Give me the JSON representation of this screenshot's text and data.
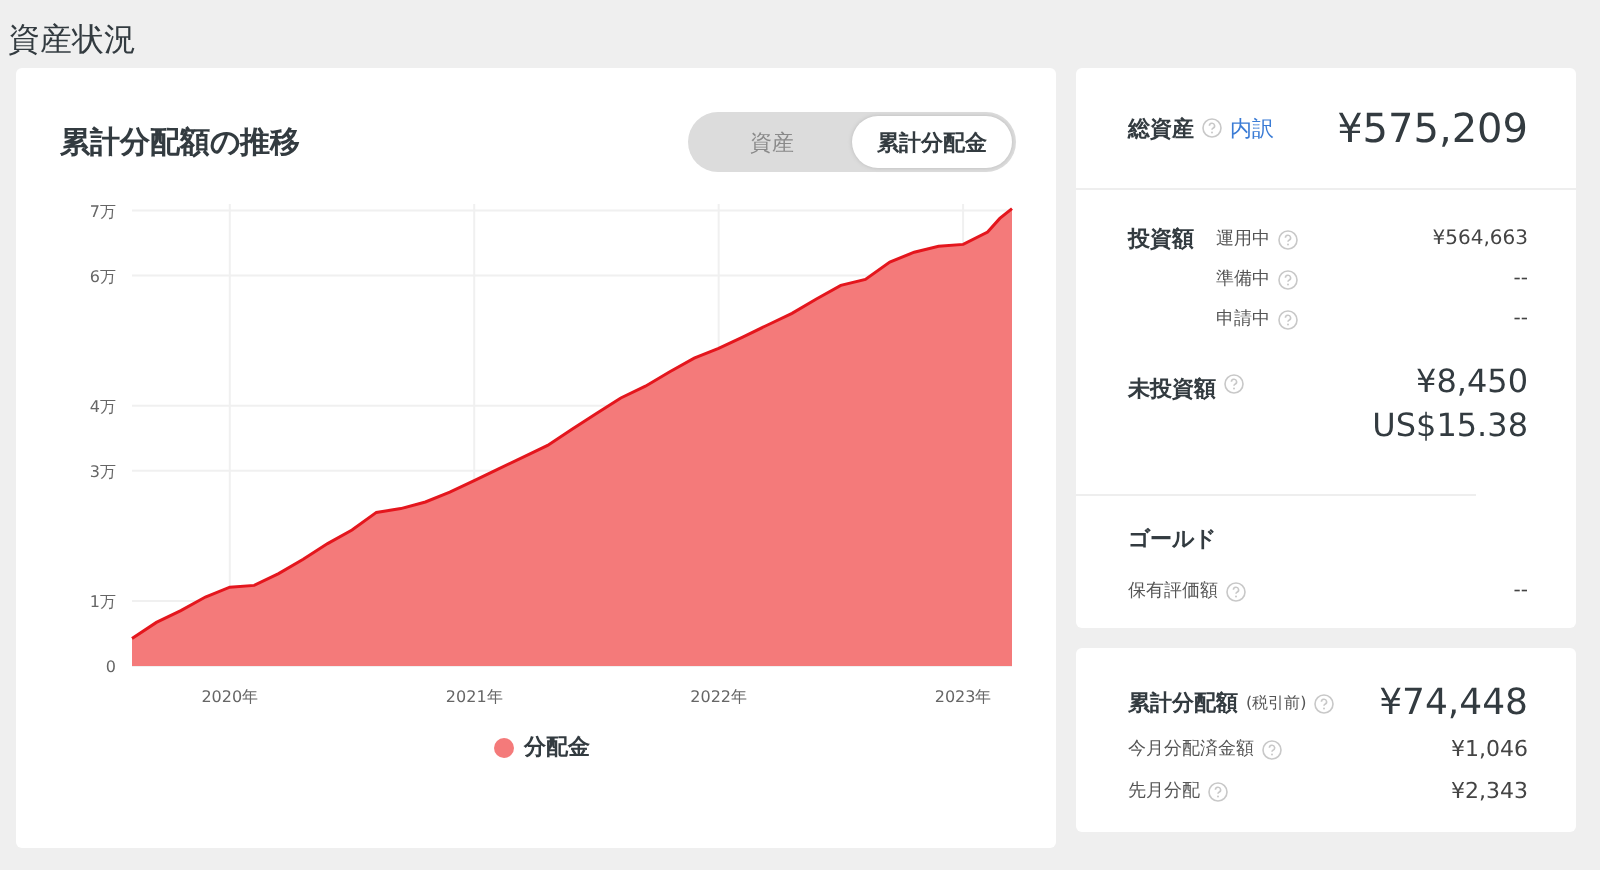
{
  "page_title": "資産状況",
  "chart_card": {
    "title": "累計分配額の推移",
    "toggle": [
      {
        "label": "資産",
        "selected": false
      },
      {
        "label": "累計分配金",
        "selected": true
      }
    ],
    "chart_data": {
      "type": "area",
      "grid": true,
      "xlim": [
        2019.6,
        2023.2
      ],
      "ylim": [
        0,
        7.1
      ],
      "x": [
        2019.6,
        2019.7,
        2019.8,
        2019.9,
        2020.0,
        2020.1,
        2020.2,
        2020.3,
        2020.4,
        2020.5,
        2020.6,
        2020.7,
        2020.8,
        2020.9,
        2021.0,
        2021.1,
        2021.2,
        2021.3,
        2021.4,
        2021.5,
        2021.6,
        2021.7,
        2021.8,
        2021.9,
        2022.0,
        2022.1,
        2022.2,
        2022.3,
        2022.4,
        2022.5,
        2022.6,
        2022.7,
        2022.8,
        2022.9,
        2023.0,
        2023.1,
        2023.15,
        2023.2
      ],
      "xticks": [
        {
          "value": 2020,
          "label": "2020年"
        },
        {
          "value": 2021,
          "label": "2021年"
        },
        {
          "value": 2022,
          "label": "2022年"
        },
        {
          "value": 2023,
          "label": "2023年"
        }
      ],
      "yticks": [
        {
          "value": 0,
          "label": "0"
        },
        {
          "value": 1,
          "label": "1万"
        },
        {
          "value": 3,
          "label": "3万"
        },
        {
          "value": 4,
          "label": "4万"
        },
        {
          "value": 6,
          "label": "6万"
        },
        {
          "value": 7,
          "label": "7万"
        }
      ],
      "series": [
        {
          "name": "分配金",
          "color": "#f47a7a",
          "values": [
            0.42,
            0.67,
            0.85,
            1.06,
            1.21,
            1.24,
            1.42,
            1.64,
            1.88,
            2.09,
            2.36,
            2.42,
            2.52,
            2.67,
            2.85,
            3.03,
            3.21,
            3.39,
            3.64,
            3.88,
            4.12,
            4.3,
            4.52,
            4.73,
            4.88,
            5.06,
            5.24,
            5.42,
            5.64,
            5.85,
            5.94,
            6.21,
            6.36,
            6.45,
            6.48,
            6.67,
            6.88,
            7.03
          ]
        }
      ]
    }
  },
  "assets": {
    "total": {
      "label": "総資産",
      "link": "内訳",
      "value": "¥575,209"
    },
    "invested": {
      "label": "投資額",
      "rows": [
        {
          "label": "運用中",
          "value": "¥564,663"
        },
        {
          "label": "準備中",
          "value": "--"
        },
        {
          "label": "申請中",
          "value": "--"
        }
      ]
    },
    "uninvested": {
      "label": "未投資額",
      "values": [
        "¥8,450",
        "US$15.38"
      ]
    },
    "gold": {
      "title": "ゴールド",
      "rows": [
        {
          "label": "保有評価額",
          "value": "--"
        }
      ]
    }
  },
  "distribution": {
    "label": "累計分配額",
    "note": "(税引前)",
    "value": "¥74,448",
    "rows": [
      {
        "label": "今月分配済金額",
        "value": "¥1,046"
      },
      {
        "label": "先月分配",
        "value": "¥2,343"
      }
    ]
  }
}
